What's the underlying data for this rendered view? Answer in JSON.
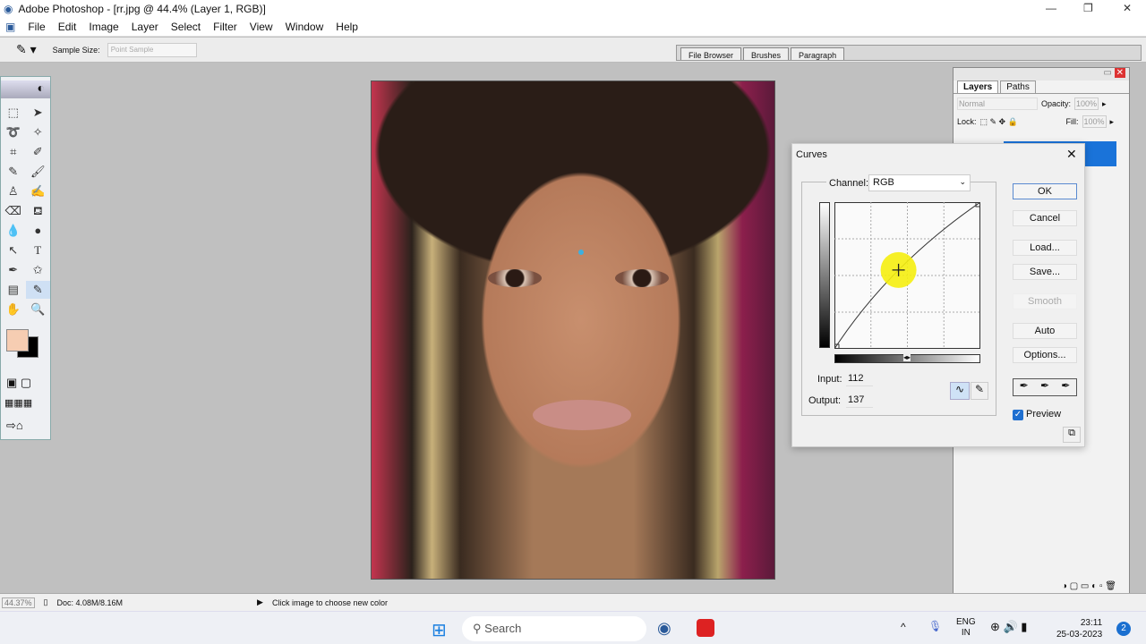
{
  "window": {
    "title": "Adobe Photoshop - [rr.jpg @ 44.4% (Layer 1, RGB)]"
  },
  "menu": [
    "File",
    "Edit",
    "Image",
    "Layer",
    "Select",
    "Filter",
    "View",
    "Window",
    "Help"
  ],
  "options": {
    "sample_size_label": "Sample Size:",
    "sample_size_value": "Point Sample"
  },
  "palette_well": [
    "File Browser",
    "Brushes",
    "Paragraph"
  ],
  "toolbox": {
    "foreground_color": "#f6cdb2",
    "background_color": "#000000"
  },
  "layers": {
    "tabs": [
      "Layers",
      "Paths"
    ],
    "blend_mode": "Normal",
    "opacity_label": "Opacity:",
    "opacity": "100%",
    "lock_label": "Lock:",
    "fill_label": "Fill:",
    "fill": "100%"
  },
  "curves": {
    "title": "Curves",
    "channel_label": "Channel:",
    "channel": "RGB",
    "input_label": "Input:",
    "input": "112",
    "output_label": "Output:",
    "output": "137",
    "buttons": {
      "ok": "OK",
      "cancel": "Cancel",
      "load": "Load...",
      "save": "Save...",
      "smooth": "Smooth",
      "auto": "Auto",
      "options": "Options..."
    },
    "preview_label": "Preview",
    "preview_checked": true,
    "curve_points": [
      [
        0,
        0
      ],
      [
        112,
        137
      ],
      [
        255,
        255
      ]
    ]
  },
  "status": {
    "zoom": "44.37%",
    "doc": "Doc: 4.08M/8.16M",
    "hint": "Click image to choose new color"
  },
  "taskbar": {
    "search": "Search",
    "lang1": "ENG",
    "lang2": "IN",
    "time": "23:11",
    "date": "25-03-2023",
    "notifications": "2"
  }
}
